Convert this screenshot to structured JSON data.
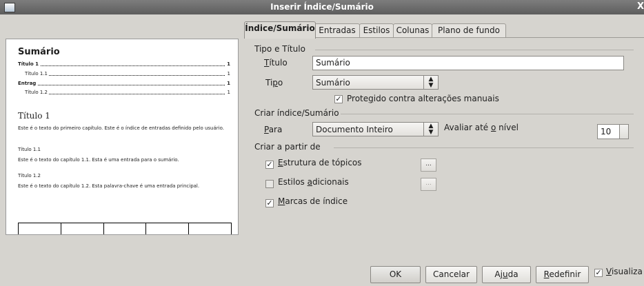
{
  "window": {
    "title": "Inserir Índice/Sumário",
    "close_glyph": "X"
  },
  "preview": {
    "main_title": "Sumário",
    "toc": [
      {
        "text": "Título 1",
        "page": "1",
        "bold": true
      },
      {
        "text": "Título 1.1",
        "page": "1",
        "bold": false
      },
      {
        "text": "Entrag",
        "page": "1",
        "bold": true
      },
      {
        "text": "Título 1.2",
        "page": "1",
        "bold": false
      }
    ],
    "heading1": "Título 1",
    "body1": "Este é o texto do primeiro capítulo. Este é o índice de entradas definido pelo usuário.",
    "heading11": "Título 1.1",
    "body11": "Este é o texto do capítulo 1.1. Esta é uma entrada para o sumário.",
    "heading12": "Título 1.2",
    "body12": "Este é o texto do capítulo 1.2. Esta palavra-chave é uma entrada principal."
  },
  "tabs": [
    "Índice/Sumário",
    "Entradas",
    "Estilos",
    "Colunas",
    "Plano de fundo"
  ],
  "type_title": {
    "section": "Tipo e Título",
    "title_label_u": "T",
    "title_label_rest": "ítulo",
    "title_value": "Sumário",
    "type_label_pre": "Ti",
    "type_label_u": "p",
    "type_label_post": "o",
    "type_value": "Sumário",
    "protected_pre": "Prote",
    "protected_u": "g",
    "protected_post": "ido contra alterações manuais",
    "protected_checked": true
  },
  "create_index": {
    "section": "Criar índice/Sumário",
    "for_label_u": "P",
    "for_label_rest": "ara",
    "for_value": "Documento Inteiro",
    "eval_pre": "Avaliar até ",
    "eval_u": "o",
    "eval_post": " nível",
    "level_value": "10"
  },
  "create_from": {
    "section": "Criar a partir de",
    "items": [
      {
        "pre": "",
        "u": "E",
        "post": "strutura de tópicos",
        "checked": true,
        "enabled": true
      },
      {
        "pre": "Estilos ",
        "u": "a",
        "post": "dicionais",
        "checked": false,
        "enabled": false
      },
      {
        "pre": "",
        "u": "M",
        "post": "arcas de índice",
        "checked": true,
        "enabled": true
      }
    ],
    "browse_glyph": "..."
  },
  "buttons": {
    "ok": "OK",
    "cancel": "Cancelar",
    "help_pre": "Aj",
    "help_u": "u",
    "help_post": "da",
    "reset_u": "R",
    "reset_rest": "edefinir",
    "preview_u": "V",
    "preview_rest": "isualiza",
    "preview_checked": true
  }
}
